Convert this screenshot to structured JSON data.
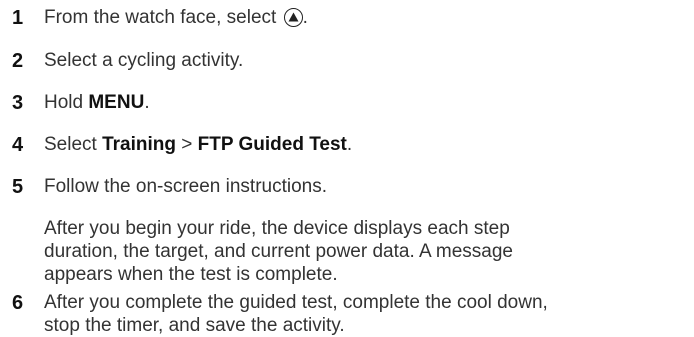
{
  "steps": [
    {
      "number": "1",
      "text_before": "From the watch face, select ",
      "icon": "up-button-icon",
      "text_after": "."
    },
    {
      "number": "2",
      "text": "Select a cycling activity."
    },
    {
      "number": "3",
      "text_before": "Hold ",
      "bold": "MENU",
      "text_after": "."
    },
    {
      "number": "4",
      "text_before": "Select ",
      "bold1": "Training",
      "separator": " > ",
      "bold2": "FTP Guided Test",
      "text_after": "."
    },
    {
      "number": "5",
      "text": "Follow the on-screen instructions.",
      "note_lines": [
        "After you begin your ride, the device displays each step",
        "duration, the target, and current power data. A message",
        "appears when the test is complete."
      ]
    },
    {
      "number": "6",
      "lines": [
        "After you complete the guided test, complete the cool down,",
        "stop the timer, and save the activity."
      ]
    }
  ]
}
